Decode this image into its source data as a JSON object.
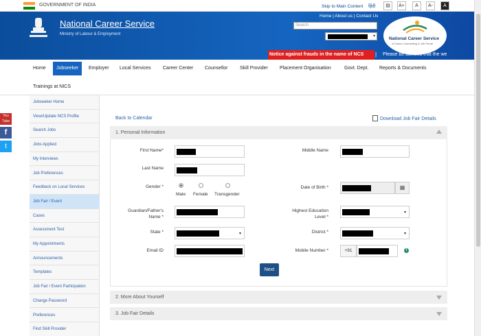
{
  "gov": {
    "text": "GOVERNMENT OF INDIA"
  },
  "top_links": {
    "skip": "Skip to Main Content",
    "hindi": "हिंदी"
  },
  "tools": [
    "A+",
    "A",
    "A-",
    "A"
  ],
  "header": {
    "title": "National Career Service",
    "subtitle": "Ministry of Labour & Employment",
    "links": "Home | About us | Contact Us",
    "search_placeholder": "Search",
    "logo_text": "National Career Service",
    "logo_sub": "A Career Counseling & Job Portal"
  },
  "ticker": {
    "alert": "Notice against frauds in the name of NCS",
    "separator": "|",
    "text": "Please be advised that the we"
  },
  "nav": {
    "items": [
      "Home",
      "Jobseeker",
      "Employer",
      "Local Services",
      "Career Center",
      "Counsellor",
      "Skill Provider",
      "Placement Organisation",
      "Govt. Dept.",
      "Reports & Documents"
    ],
    "row2": "Trainings at NICS"
  },
  "social": {
    "youtube": "You Tube",
    "facebook": "f",
    "twitter": "t"
  },
  "sidebar": {
    "items": [
      "Jobseeker Home",
      "View/Update NCS Profile",
      "Search Jobs",
      "Jobs Applied",
      "My Interviews",
      "Job Preferences",
      "Feedback on Local Services",
      "Job Fair / Event",
      "Cases",
      "Assessment Test",
      "My Appointments",
      "Announcements",
      "Templates",
      "Job Fair / Event Participation",
      "Change Password",
      "Preferences",
      "Find Skill Provider"
    ]
  },
  "content": {
    "back": "Back to Calendar",
    "download": "Download Job Fair Details",
    "section1": "1. Personal Information",
    "section2": "2. More About Yourself",
    "section3": "3. Job Fair Details",
    "next": "Next"
  },
  "form": {
    "first_name": "First Name*",
    "middle_name": "Middle Name",
    "last_name": "Last Name",
    "gender": "Gender *",
    "gender_options": [
      "Male",
      "Female",
      "Transgender"
    ],
    "dob": "Date of Birth *",
    "guardian_l1": "Guardian/Father's",
    "guardian_l2": "Name *",
    "education_l1": "Highest Education",
    "education_l2": "Level *",
    "state": "State *",
    "district": "District *",
    "email": "Email ID",
    "mobile": "Mobile Number *",
    "prefix": "+91"
  }
}
